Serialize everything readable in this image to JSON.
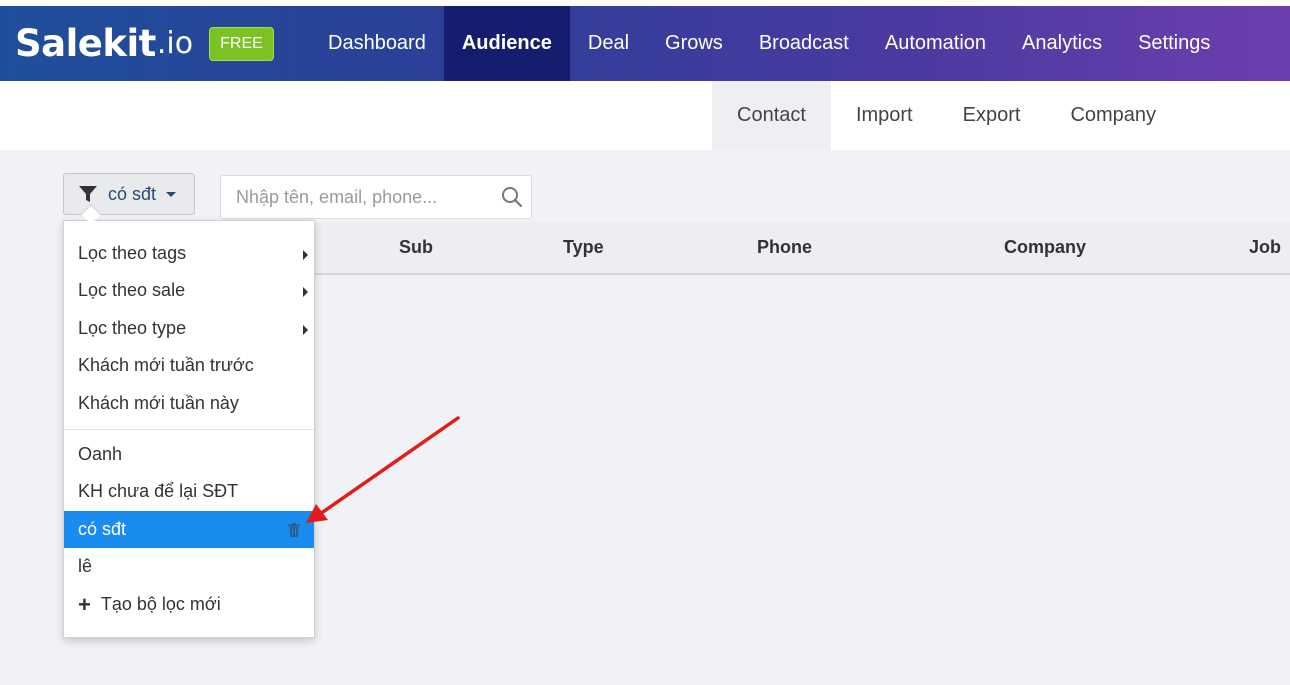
{
  "brand": {
    "logo_main": "Salekit",
    "logo_suffix": ".io",
    "plan_badge": "FREE"
  },
  "nav": {
    "items": [
      {
        "label": "Dashboard",
        "active": false
      },
      {
        "label": "Audience",
        "active": true
      },
      {
        "label": "Deal",
        "active": false
      },
      {
        "label": "Grows",
        "active": false
      },
      {
        "label": "Broadcast",
        "active": false
      },
      {
        "label": "Automation",
        "active": false
      },
      {
        "label": "Analytics",
        "active": false
      },
      {
        "label": "Settings",
        "active": false
      }
    ]
  },
  "subnav": {
    "items": [
      {
        "label": "Contact",
        "active": true
      },
      {
        "label": "Import",
        "active": false
      },
      {
        "label": "Export",
        "active": false
      },
      {
        "label": "Company",
        "active": false
      }
    ]
  },
  "filter": {
    "selected_label": "có sđt"
  },
  "search": {
    "placeholder": "Nhập tên, email, phone...",
    "value": ""
  },
  "table": {
    "columns": [
      "Sub",
      "Type",
      "Phone",
      "Company",
      "Job"
    ]
  },
  "dropdown": {
    "filter_groups": [
      {
        "label": "Lọc theo tags",
        "has_submenu": true
      },
      {
        "label": "Lọc theo sale",
        "has_submenu": true
      },
      {
        "label": "Lọc theo type",
        "has_submenu": true
      },
      {
        "label": "Khách mới tuần trước",
        "has_submenu": false
      },
      {
        "label": "Khách mới tuần này",
        "has_submenu": false
      }
    ],
    "saved_filters": [
      {
        "label": "Oanh",
        "selected": false
      },
      {
        "label": "KH chưa để lại SĐT",
        "selected": false
      },
      {
        "label": "có sđt",
        "selected": true
      },
      {
        "label": "lê",
        "selected": false
      }
    ],
    "new_filter_label": "Tạo bộ lọc mới"
  },
  "colors": {
    "accent": "#1a8cf0",
    "nav_active": "#161d6f",
    "free_badge": "#7cc225",
    "annotation": "#e51b1b"
  },
  "icons": {
    "filter": "funnel-icon",
    "search": "search-icon",
    "delete": "trash-icon",
    "add": "plus-icon"
  }
}
